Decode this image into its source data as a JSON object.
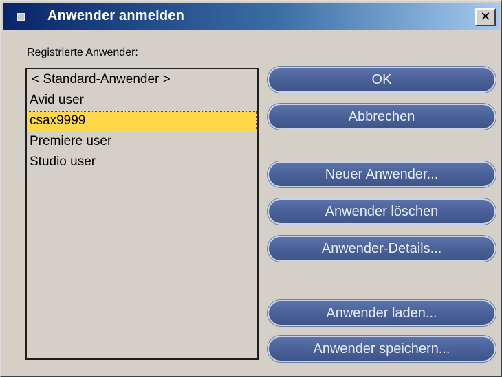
{
  "window": {
    "title": "Anwender anmelden",
    "close_symbol": "✕"
  },
  "list": {
    "label": "Registrierte Anwender:",
    "items": [
      {
        "label": "< Standard-Anwender >",
        "selected": false
      },
      {
        "label": "Avid user",
        "selected": false
      },
      {
        "label": "csax9999",
        "selected": true
      },
      {
        "label": "Premiere user",
        "selected": false
      },
      {
        "label": "Studio user",
        "selected": false
      }
    ]
  },
  "buttons": {
    "ok": "OK",
    "cancel": "Abbrechen",
    "new_user": "Neuer Anwender...",
    "delete_user": "Anwender löschen",
    "user_details": "Anwender-Details...",
    "load_user": "Anwender laden...",
    "save_user": "Anwender speichern..."
  },
  "colors": {
    "titlebar_start": "#0a246a",
    "titlebar_end": "#a6caf0",
    "button_fill": "#4a6199",
    "selection": "#ffd84a",
    "dialog_bg": "#d4d0c8"
  },
  "icons": {
    "title_icon": "window-menu-icon",
    "close_icon": "close-icon"
  }
}
